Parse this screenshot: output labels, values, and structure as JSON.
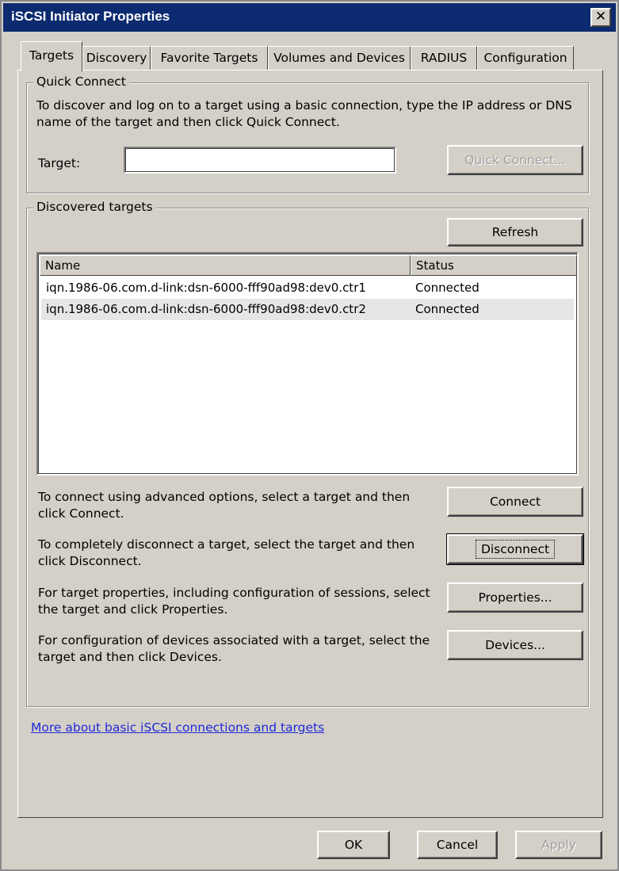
{
  "window": {
    "title": "iSCSI Initiator Properties",
    "close_glyph": "✕"
  },
  "tabs": [
    {
      "label": "Targets",
      "active": true
    },
    {
      "label": "Discovery"
    },
    {
      "label": "Favorite Targets"
    },
    {
      "label": "Volumes and Devices"
    },
    {
      "label": "RADIUS"
    },
    {
      "label": "Configuration"
    }
  ],
  "quick_connect": {
    "group_label": "Quick Connect",
    "description": "To discover and log on to a target using a basic connection, type the IP address or DNS name of the target and then click Quick Connect.",
    "target_label": "Target:",
    "target_value": "",
    "button_label": "Quick Connect..."
  },
  "discovered": {
    "group_label": "Discovered targets",
    "refresh_label": "Refresh",
    "columns": [
      "Name",
      "Status"
    ],
    "rows": [
      {
        "name": "iqn.1986-06.com.d-link:dsn-6000-fff90ad98:dev0.ctr1",
        "status": "Connected"
      },
      {
        "name": "iqn.1986-06.com.d-link:dsn-6000-fff90ad98:dev0.ctr2",
        "status": "Connected"
      }
    ],
    "connect_text": "To connect using advanced options, select a target and then click Connect.",
    "connect_label": "Connect",
    "disconnect_text": "To completely disconnect a target, select the target and then click Disconnect.",
    "disconnect_label": "Disconnect",
    "properties_text": "For target properties, including configuration of sessions, select the target and click Properties.",
    "properties_label": "Properties...",
    "devices_text": "For configuration of devices associated with a target, select the target and then click Devices.",
    "devices_label": "Devices..."
  },
  "link": "More about basic iSCSI connections and targets",
  "footer": {
    "ok": "OK",
    "cancel": "Cancel",
    "apply": "Apply"
  }
}
